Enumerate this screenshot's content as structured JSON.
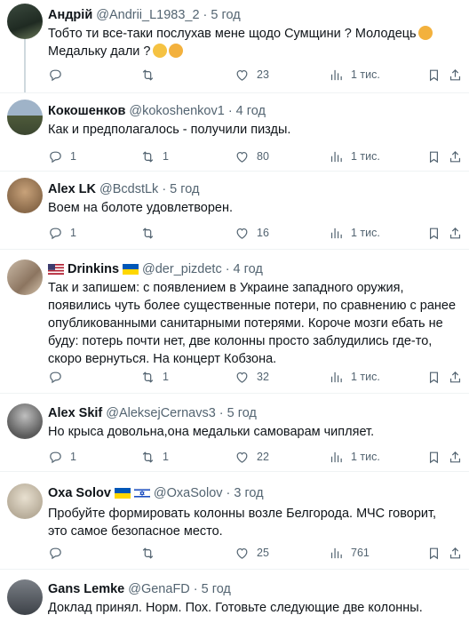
{
  "tweets": [
    {
      "name": "Андрій",
      "handle": "@Andrii_L1983_2",
      "time": "5 год",
      "text": "Тобто ти все-таки послухав мене щодо Сумщини ? Молодець",
      "text2": "Медальку дали ?",
      "replies": "",
      "retweets": "",
      "likes": "23",
      "views": "1 тис."
    },
    {
      "name": "Кокошенков",
      "handle": "@kokoshenkov1",
      "time": "4 год",
      "text": "Как и предполагалось - получили пизды.",
      "replies": "1",
      "retweets": "1",
      "likes": "80",
      "views": "1 тис."
    },
    {
      "name": "Alex LK",
      "handle": "@BcdstLk",
      "time": "5 год",
      "text": "Воем на болоте удовлетворен.",
      "replies": "1",
      "retweets": "",
      "likes": "16",
      "views": "1 тис."
    },
    {
      "name": "Drinkins",
      "handle": "@der_pizdetc",
      "time": "4 год",
      "text": "Так и запишем: с появлением в Украине западного оружия, появились чуть более существенные потери, по сравнению с ранее опубликованными санитарными потерями. Короче мозги ебать не буду: потерь почти нет, две колонны просто заблудились где-то, скоро вернуться. На концерт Кобзона.",
      "replies": "",
      "retweets": "1",
      "likes": "32",
      "views": "1 тис."
    },
    {
      "name": "Alex Skif",
      "handle": "@AleksejCernavs3",
      "time": "5 год",
      "text": "Но крыса довольна,она медальки самоварам чипляет.",
      "replies": "1",
      "retweets": "1",
      "likes": "22",
      "views": "1 тис."
    },
    {
      "name": "Oxa Solov",
      "handle": "@OxaSolov",
      "time": "3 год",
      "text": "Пробуйте формировать колонны возле Белгорода. МЧС говорит, это самое безопасное место.",
      "replies": "",
      "retweets": "",
      "likes": "25",
      "views": "761"
    },
    {
      "name": "Gans Lemke",
      "handle": "@GenaFD",
      "time": "5 год",
      "text": "Доклад принял. Норм. Пох. Готовьте следующие две колонны."
    }
  ],
  "separator": "·",
  "colors": {
    "muted": "#536471",
    "text": "#0f1419",
    "divider": "#eff3f4"
  },
  "icons": [
    "reply-icon",
    "retweet-icon",
    "like-icon",
    "views-icon",
    "bookmark-icon",
    "share-icon"
  ]
}
